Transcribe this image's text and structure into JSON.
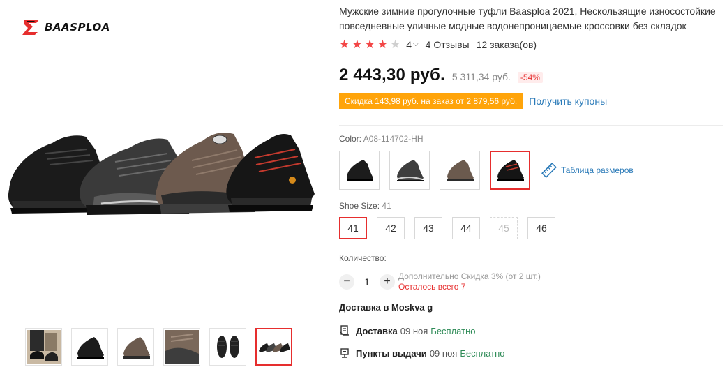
{
  "brand": {
    "name": "BAASPLOA"
  },
  "product": {
    "title": "Мужские зимние прогулочные туфли Baasploa 2021, Нескользящие износостойкие повседневные уличные модные водонепроницаемые кроссовки без складок",
    "rating": {
      "value": "4",
      "stars": 4,
      "max_stars": 5,
      "reviews": "4 Отзывы",
      "orders": "12 заказа(ов)"
    },
    "price": {
      "current": "2 443,30 руб.",
      "old": "5 311,34 руб.",
      "discount": "-54%"
    },
    "coupon": {
      "tag": "Скидка 143,98 руб. на заказ от 2 879,56 руб.",
      "link": "Получить купоны"
    }
  },
  "color": {
    "label": "Color:",
    "selected": "A08-114702-HH",
    "options": [
      "black",
      "grey",
      "brown",
      "black-red"
    ],
    "active_index": 3,
    "size_table_link": "Таблица размеров"
  },
  "sizes": {
    "label": "Shoe Size:",
    "selected": "41",
    "options": [
      "41",
      "42",
      "43",
      "44",
      "45",
      "46"
    ],
    "active_index": 0,
    "disabled": [
      "45"
    ]
  },
  "quantity": {
    "label": "Количество:",
    "value": "1",
    "minus": "−",
    "plus": "+",
    "extra_discount": "Дополнительно Скидка 3% (от 2 шт.)",
    "stock_left": "Осталось всего 7"
  },
  "delivery": {
    "title": "Доставка в Moskva g",
    "rows": [
      {
        "name": "Доставка",
        "date": "09 ноя",
        "cost": "Бесплатно",
        "icon": "delivery-doc-icon"
      },
      {
        "name": "Пункты выдачи",
        "date": "09 ноя",
        "cost": "Бесплатно",
        "icon": "pickup-point-icon"
      }
    ]
  },
  "gallery": {
    "thumbnails": [
      "lifestyle-photo",
      "black-shoe",
      "brown-shoe",
      "brown-shoe-detail",
      "outsole",
      "four-shoes"
    ],
    "active_index": 5
  },
  "colors_palette": {
    "accent": "#e62e2e",
    "coupon": "#ffa40a",
    "link": "#2a7ab8",
    "free": "#2e8b57"
  }
}
